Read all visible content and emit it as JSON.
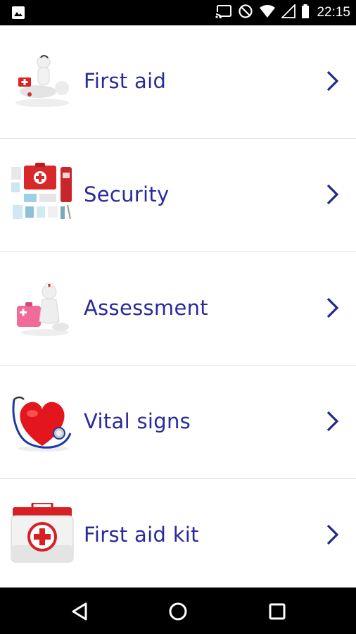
{
  "status_bar": {
    "time": "22:15",
    "icons": [
      "image-notification-icon",
      "cast-icon",
      "do-not-disturb-icon",
      "wifi-icon",
      "cell-signal-icon",
      "battery-icon"
    ]
  },
  "menu": {
    "items": [
      {
        "label": "First aid",
        "icon": "first-aid-figure-icon"
      },
      {
        "label": "Security",
        "icon": "medical-supplies-icon"
      },
      {
        "label": "Assessment",
        "icon": "assessment-figure-icon"
      },
      {
        "label": "Vital signs",
        "icon": "heart-stethoscope-icon"
      },
      {
        "label": "First aid kit",
        "icon": "first-aid-kit-icon"
      }
    ],
    "accent_color": "#2a2a9c",
    "chevron_color": "#1f2a8a"
  },
  "nav_bar": {
    "buttons": [
      "back-icon",
      "home-icon",
      "recents-icon"
    ]
  }
}
